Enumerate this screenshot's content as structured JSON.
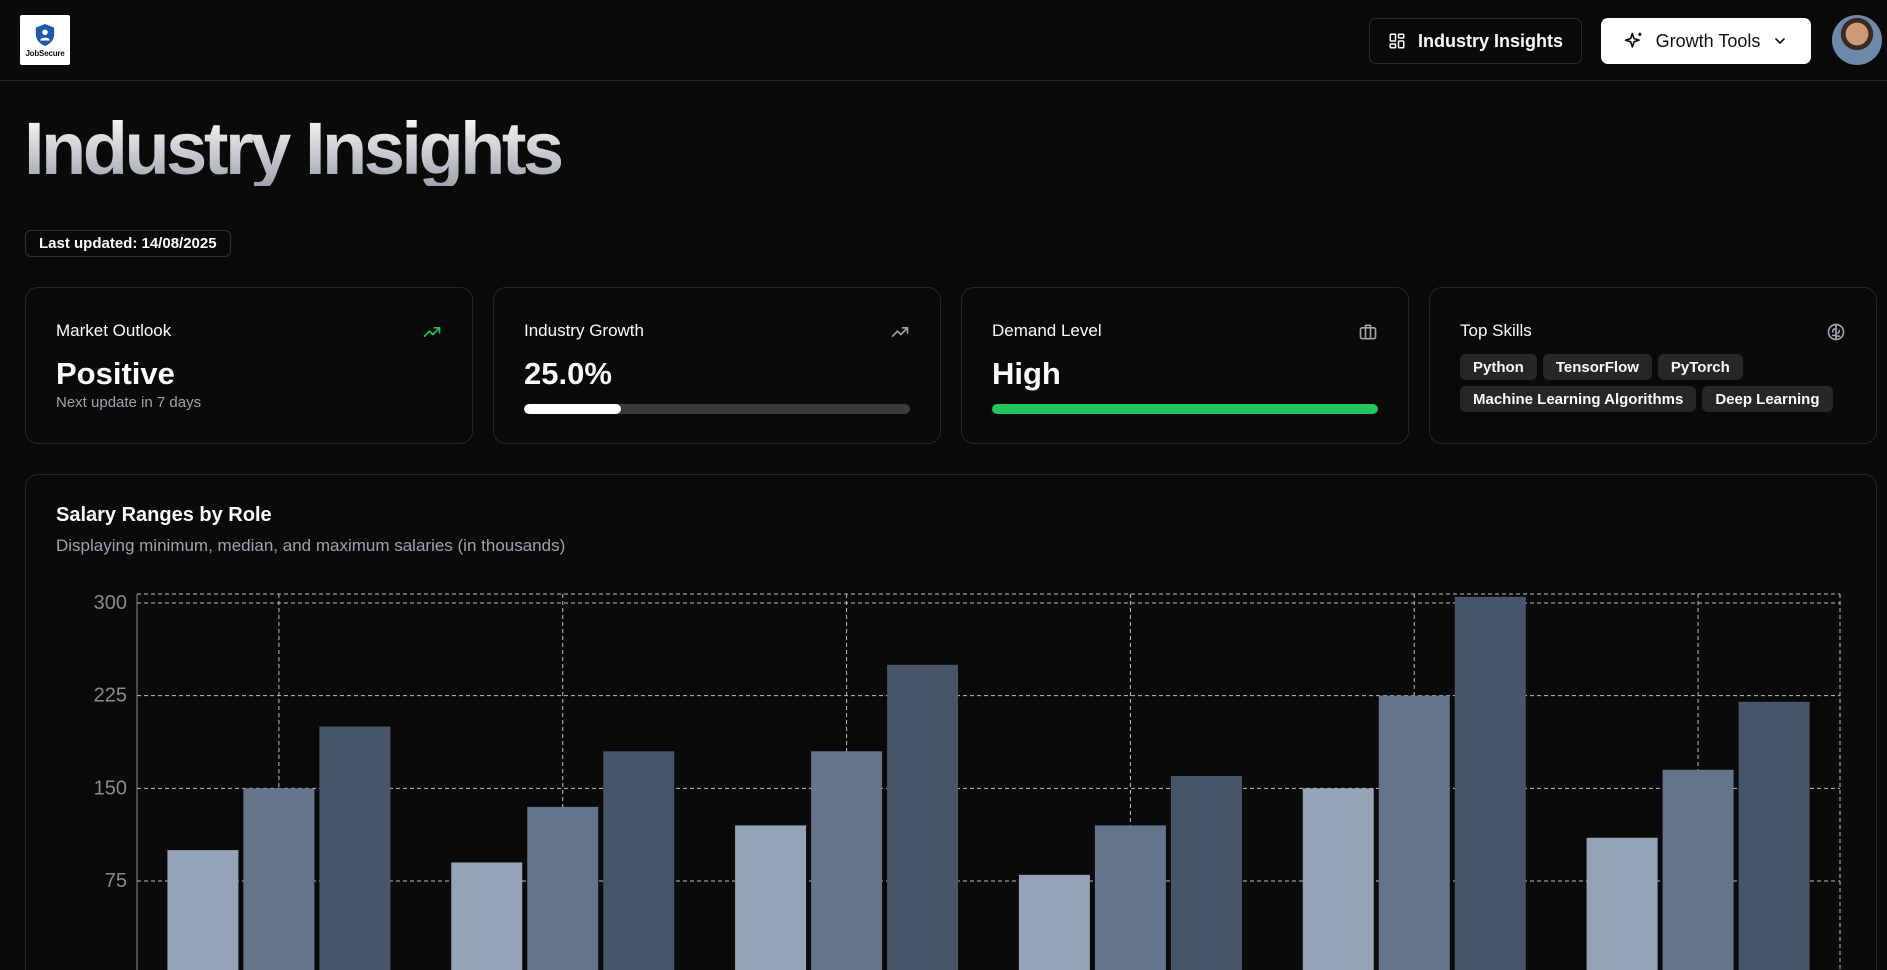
{
  "header": {
    "logo_text": "JobSecure",
    "insights_label": "Industry Insights",
    "growth_label": "Growth Tools"
  },
  "page": {
    "title": "Industry Insights",
    "last_updated": "Last updated: 14/08/2025"
  },
  "cards": {
    "market": {
      "title": "Market Outlook",
      "value": "Positive",
      "sub": "Next update in 7 days",
      "icon": "trending-up-icon",
      "icon_color": "#22c55e"
    },
    "growth": {
      "title": "Industry Growth",
      "value": "25.0%",
      "progress": 0.25,
      "icon": "trending-up-icon"
    },
    "demand": {
      "title": "Demand Level",
      "value": "High",
      "progress": 1.0,
      "bar_color": "#22c55e",
      "icon": "briefcase-icon"
    },
    "skills": {
      "title": "Top Skills",
      "icon": "brain-icon",
      "items": [
        "Python",
        "TensorFlow",
        "PyTorch",
        "Machine Learning Algorithms",
        "Deep Learning"
      ]
    }
  },
  "salary_chart": {
    "title": "Salary Ranges by Role",
    "subtitle": "Displaying minimum, median, and maximum salaries (in thousands)"
  },
  "chart_data": {
    "type": "bar",
    "yticks": [
      75,
      150,
      225,
      300
    ],
    "ylim": [
      50,
      305
    ],
    "grid": true,
    "series": [
      {
        "values": [
          100,
          90,
          120,
          80,
          150,
          110
        ],
        "color": "#94a3b8"
      },
      {
        "values": [
          150,
          135,
          180,
          120,
          225,
          165
        ],
        "color": "#64748b"
      },
      {
        "values": [
          200,
          180,
          250,
          160,
          305,
          220
        ],
        "color": "#475569"
      }
    ]
  },
  "colors": {
    "background": "#0a0a0a",
    "border": "#262626",
    "accent_green": "#22c55e"
  }
}
